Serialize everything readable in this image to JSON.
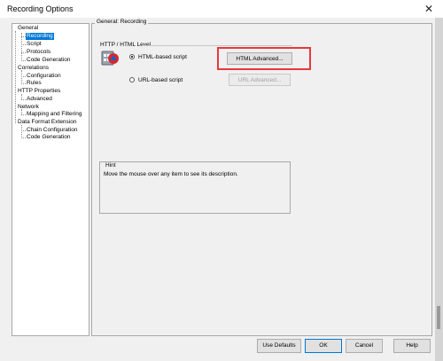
{
  "window": {
    "title": "Recording Options"
  },
  "tree": {
    "items": [
      {
        "label": "General"
      },
      {
        "label": "Recording",
        "selected": true
      },
      {
        "label": "Script"
      },
      {
        "label": "Protocols"
      },
      {
        "label": "Code Generation"
      },
      {
        "label": "Correlations"
      },
      {
        "label": "Configuration"
      },
      {
        "label": "Rules"
      },
      {
        "label": "HTTP Properties"
      },
      {
        "label": "Advanced"
      },
      {
        "label": "Network"
      },
      {
        "label": "Mapping and Filtering"
      },
      {
        "label": "Data Format Extension"
      },
      {
        "label": "Chain Configuration"
      },
      {
        "label": "Code Generation"
      }
    ]
  },
  "panel": {
    "title": "General: Recording",
    "group_label": "HTTP / HTML Level",
    "options": [
      {
        "label": "HTML-based script",
        "checked": true,
        "button": "HTML Advanced...",
        "button_enabled": true
      },
      {
        "label": "URL-based script",
        "checked": false,
        "button": "URL Advanced...",
        "button_enabled": false
      }
    ],
    "hint": {
      "label": "Hint",
      "text": "Move the mouse over any item to see its description."
    }
  },
  "footer": {
    "use_defaults": "Use Defaults",
    "ok": "OK",
    "cancel": "Cancel",
    "help": "Help"
  },
  "icons": {
    "close": "close-icon",
    "app": "recording-app-icon"
  },
  "colors": {
    "selection": "#0078d7",
    "highlight": "#e8383d"
  }
}
